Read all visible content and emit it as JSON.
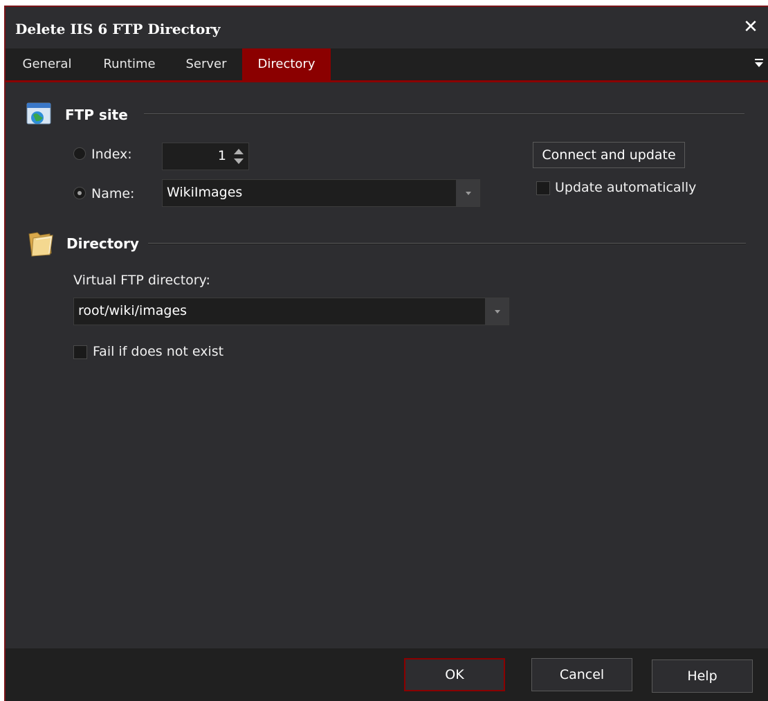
{
  "window": {
    "title": "Delete IIS 6 FTP Directory",
    "close_icon": "close-icon"
  },
  "tabs": [
    {
      "label": "General",
      "active": false
    },
    {
      "label": "Runtime",
      "active": false
    },
    {
      "label": "Server",
      "active": false
    },
    {
      "label": "Directory",
      "active": true
    }
  ],
  "ftp_site": {
    "section_title": "FTP site",
    "index_label": "Index:",
    "index_value": "1",
    "name_label": "Name:",
    "name_value": "WikiImages",
    "selected_option": "name",
    "connect_button": "Connect and update",
    "update_auto_label": "Update automatically",
    "update_auto_checked": false
  },
  "directory": {
    "section_title": "Directory",
    "virtual_label": "Virtual FTP directory:",
    "virtual_value": "root/wiki/images",
    "fail_label": "Fail if does not exist",
    "fail_checked": false
  },
  "footer": {
    "ok": "OK",
    "cancel": "Cancel",
    "help": "Help"
  },
  "colors": {
    "accent": "#8b0000",
    "background": "#2d2d30",
    "field": "#1e1e1e"
  }
}
